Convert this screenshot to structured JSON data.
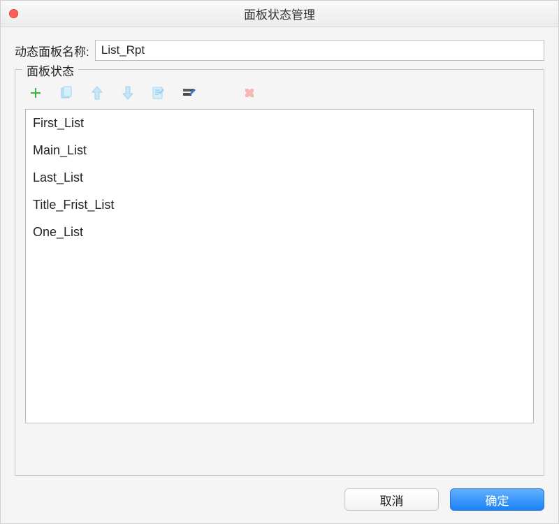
{
  "window": {
    "title": "面板状态管理"
  },
  "name_field": {
    "label": "动态面板名称:",
    "value": "List_Rpt"
  },
  "fieldset": {
    "legend": "面板状态"
  },
  "toolbar": {
    "icons": {
      "add": "add-icon",
      "copy": "copy-icon",
      "up": "arrow-up-icon",
      "down": "arrow-down-icon",
      "edit": "edit-icon",
      "edit2": "edit2-icon",
      "delete": "delete-icon"
    }
  },
  "states": [
    "First_List",
    "Main_List",
    "Last_List",
    "Title_Frist_List",
    "One_List"
  ],
  "footer": {
    "cancel": "取消",
    "ok": "确定"
  }
}
